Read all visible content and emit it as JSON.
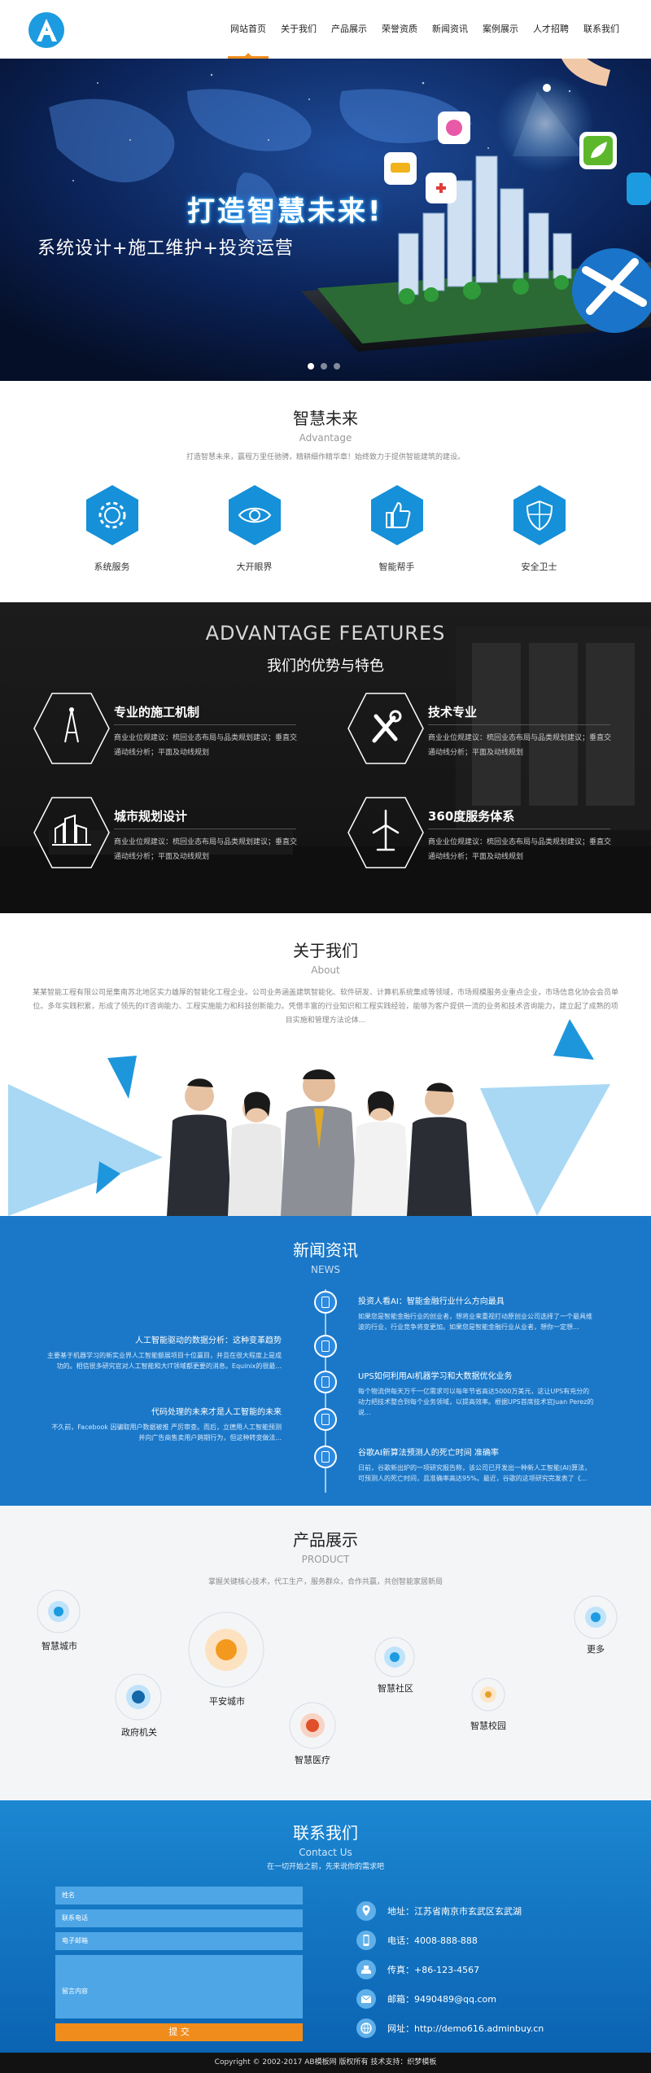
{
  "header": {
    "logo_letter": "A",
    "nav": [
      "网站首页",
      "关于我们",
      "产品展示",
      "荣誉资质",
      "新闻资讯",
      "案例展示",
      "人才招聘",
      "联系我们"
    ]
  },
  "banner": {
    "title": "打造智慧未来!",
    "subtitle": "系统设计+施工维护+投资运营",
    "slides": 3
  },
  "intro": {
    "title": "智慧未来",
    "subtitle": "Advantage",
    "desc": "打造智慧未来，赢程万里任驰骋，精耕细作精华章！始终致力于提供智能建筑的建设。",
    "services": [
      {
        "label": "系统服务",
        "icon": "gear-icon"
      },
      {
        "label": "大开眼界",
        "icon": "eye-icon"
      },
      {
        "label": "智能帮手",
        "icon": "thumbs-up-icon"
      },
      {
        "label": "安全卫士",
        "icon": "shield-icon"
      }
    ]
  },
  "advantages": {
    "title_en": "ADVANTAGE FEATURES",
    "title_cn": "我们的优势与特色",
    "items": [
      {
        "title": "专业的施工机制",
        "desc": "商业业位规建议：梳回业态布局与品类规划建议；垂直交通动线分析；平面及动线规划",
        "icon": "compass-icon"
      },
      {
        "title": "技术专业",
        "desc": "商业业位规建议：梳回业态布局与品类规划建议；垂直交通动线分析；平面及动线规划",
        "icon": "tools-icon"
      },
      {
        "title": "城市规划设计",
        "desc": "商业业位规建议：梳回业态布局与品类规划建议；垂直交通动线分析；平面及动线规划",
        "icon": "buildings-icon"
      },
      {
        "title": "360度服务体系",
        "desc": "商业业位规建议：梳回业态布局与品类规划建议；垂直交通动线分析；平面及动线规划",
        "icon": "wind-turbine-icon"
      }
    ]
  },
  "about": {
    "title": "关于我们",
    "subtitle": "About",
    "desc": "某某智能工程有限公司是集南苏北地区实力雄厚的智能化工程企业。公司业务涵盖建筑智能化、软件研发、计算机系统集成等领域，市场规模服务业重点企业，市场信息化协会会员单位。多年实践积累，形成了领先的IT咨询能力、工程实施能力和科技创新能力。凭借丰富的行业知识和工程实践经验，能够为客户提供一流的业务和技术咨询能力，建立起了成熟的项目实施和管理方法论体..."
  },
  "news": {
    "title": "新闻资讯",
    "subtitle": "NEWS",
    "items": [
      {
        "side": "right",
        "title": "投资人看AI：智能金融行业什么方向最具",
        "desc": "如果您是智能金融行业的创业者，想将业来重视打动原创业公司选择了一个最具维波的行业，行业竞争将变更加。如果您是智能金融行业从业者，想你一定想..."
      },
      {
        "side": "left",
        "title": "人工智能驱动的数据分析：这种变革趋势",
        "desc": "主要基于机器学习的新实业界人工智能额展项目十位赢目，并且在很大程度上是成功的。相信很多研究官对人工智能和大IT领域都更要的消息。Equinix的很最..."
      },
      {
        "side": "right",
        "title": "UPS如何利用AI机器学习和大数据优化业务",
        "desc": "每个物流供每天万千一亿需求可以每年节省高达5000万美元，这让UPS有充分的动力把技术整合到每个业务领域，以提高效率。根据UPS首席技术官Juan Perez的说..."
      },
      {
        "side": "left",
        "title": "代码处理的未来才是人工智能的未来",
        "desc": "不久前，Facebook 因骗取用户数据被推 严厉审查。而后，立德用人工智能预测并向广告商售卖用户跨期行为，但这种转变做法..."
      },
      {
        "side": "right",
        "title": "谷歌AI新算法预测人的死亡时间 准确率",
        "desc": "日前，谷歌新出炉的一项研究报告称，该公司已开发出一种新人工智能(AI)算法，可预测人的死亡时间，且准确率高达95%。最近，谷歌的这项研究完发表了《..."
      }
    ]
  },
  "products": {
    "title": "产品展示",
    "subtitle": "PRODUCT",
    "desc": "掌握关键核心技术，代工生产，服务群众，合作共赢，共创智能家居新局",
    "items": [
      "智慧城市",
      "平安城市",
      "政府机关",
      "智慧医疗",
      "智慧社区",
      "智慧校园",
      "更多"
    ]
  },
  "contact": {
    "title": "联系我们",
    "subtitle": "Contact Us",
    "desc": "在一切开始之前，先来说你的需求吧",
    "form": {
      "name_placeholder": "姓名",
      "phone_placeholder": "联系电话",
      "email_placeholder": "电子邮箱",
      "message_placeholder": "留言内容",
      "submit": "提 交"
    },
    "info": [
      {
        "icon": "location-icon",
        "text": "地址：江苏省南京市玄武区玄武湖"
      },
      {
        "icon": "phone-icon",
        "text": "电话：4008-888-888"
      },
      {
        "icon": "fax-icon",
        "text": "传真：+86-123-4567"
      },
      {
        "icon": "mail-icon",
        "text": "邮箱：9490489@qq.com"
      },
      {
        "icon": "web-icon",
        "text": "网址：http://demo616.adminbuy.cn"
      }
    ]
  },
  "footer": {
    "text": "Copyright © 2002-2017 AB模板网 版权所有  技术支持：织梦模板"
  },
  "colors": {
    "accent": "#f08c1c",
    "primary_blue": "#1b78c8",
    "hex_blue": "#1690d8"
  }
}
